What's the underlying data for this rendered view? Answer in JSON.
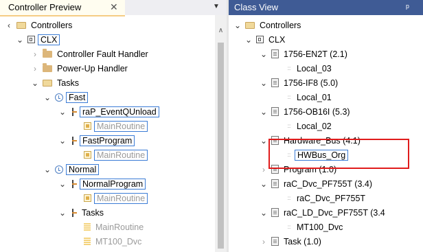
{
  "left_panel": {
    "title": "Controller Preview",
    "close_glyph": "✕",
    "dropdown_glyph": "▼",
    "tree": [
      {
        "label": "Controllers",
        "icon": "folder-open-icon",
        "chevron": "▾",
        "boxed": false,
        "dim": false
      },
      {
        "label": "CLX",
        "icon": "controller-icon",
        "chevron": "✓",
        "boxed": true,
        "dim": false
      },
      {
        "label": "Controller Fault Handler",
        "icon": "folder-icon",
        "chevron": "›",
        "boxed": false,
        "dim": false
      },
      {
        "label": "Power-Up Handler",
        "icon": "folder-icon",
        "chevron": "›",
        "boxed": false,
        "dim": false
      },
      {
        "label": "Tasks",
        "icon": "folder-open-icon",
        "chevron": "✓",
        "boxed": false,
        "dim": false
      },
      {
        "label": "Fast",
        "icon": "clock-icon",
        "chevron": "✓",
        "boxed": true,
        "dim": false
      },
      {
        "label": "raP_EventQUnload",
        "icon": "program-icon",
        "chevron": "✓",
        "boxed": true,
        "dim": false
      },
      {
        "label": "MainRoutine",
        "icon": "routine-icon",
        "chevron": "",
        "boxed": true,
        "dim": true
      },
      {
        "label": "FastProgram",
        "icon": "program-icon",
        "chevron": "✓",
        "boxed": true,
        "dim": false
      },
      {
        "label": "MainRoutine",
        "icon": "routine-icon",
        "chevron": "",
        "boxed": true,
        "dim": true
      },
      {
        "label": "Normal",
        "icon": "clock-icon",
        "chevron": "✓",
        "boxed": true,
        "dim": false
      },
      {
        "label": "NormalProgram",
        "icon": "program-icon",
        "chevron": "✓",
        "boxed": true,
        "dim": false
      },
      {
        "label": "MainRoutine",
        "icon": "routine-icon",
        "chevron": "",
        "boxed": true,
        "dim": true
      },
      {
        "label": "Tasks",
        "icon": "program-icon",
        "chevron": "✓",
        "boxed": false,
        "dim": false
      },
      {
        "label": "MainRoutine",
        "icon": "routine-plain-icon",
        "chevron": "",
        "boxed": false,
        "dim": true
      },
      {
        "label": "MT100_Dvc",
        "icon": "routine-plain-icon",
        "chevron": "",
        "boxed": false,
        "dim": true
      }
    ],
    "scroll_up_glyph": "∧"
  },
  "right_panel": {
    "title": "Class View",
    "pin_glyph": "ᵖ",
    "tree": [
      {
        "label": "Controllers",
        "icon": "folder-open-icon",
        "chevron": "✓"
      },
      {
        "label": "CLX",
        "icon": "controller-icon",
        "chevron": "✓"
      },
      {
        "label": "1756-EN2T   (2.1)",
        "icon": "module-icon",
        "chevron": "✓"
      },
      {
        "label": "Local_03",
        "icon": "member-icon",
        "chevron": ""
      },
      {
        "label": "1756-IF8   (5.0)",
        "icon": "module-icon",
        "chevron": "✓"
      },
      {
        "label": "Local_01",
        "icon": "member-icon",
        "chevron": ""
      },
      {
        "label": "1756-OB16I   (5.3)",
        "icon": "module-icon",
        "chevron": "✓"
      },
      {
        "label": "Local_02",
        "icon": "member-icon",
        "chevron": ""
      },
      {
        "label": "Hardware_Bus   (4.1)",
        "icon": "module-icon",
        "chevron": "✓"
      },
      {
        "label": "HWBus_Org",
        "icon": "member-icon",
        "chevron": ""
      },
      {
        "label": "Program   (1.0)",
        "icon": "module-icon",
        "chevron": "›"
      },
      {
        "label": "raC_Dvc_PF755T   (3.4)",
        "icon": "module-icon",
        "chevron": "✓"
      },
      {
        "label": "raC_Dvc_PF755T",
        "icon": "member-icon",
        "chevron": ""
      },
      {
        "label": "raC_LD_Dvc_PF755T   (3.4",
        "icon": "module-icon",
        "chevron": "✓"
      },
      {
        "label": "MT100_Dvc",
        "icon": "member-icon",
        "chevron": ""
      },
      {
        "label": "Task   (1.0)",
        "icon": "module-icon",
        "chevron": "›"
      }
    ]
  },
  "colors": {
    "right_tab_bg": "#3f5b95",
    "selection_border": "#3a7bd5",
    "highlight_red": "#e01b1b",
    "tab_accent": "#f5cc84"
  }
}
